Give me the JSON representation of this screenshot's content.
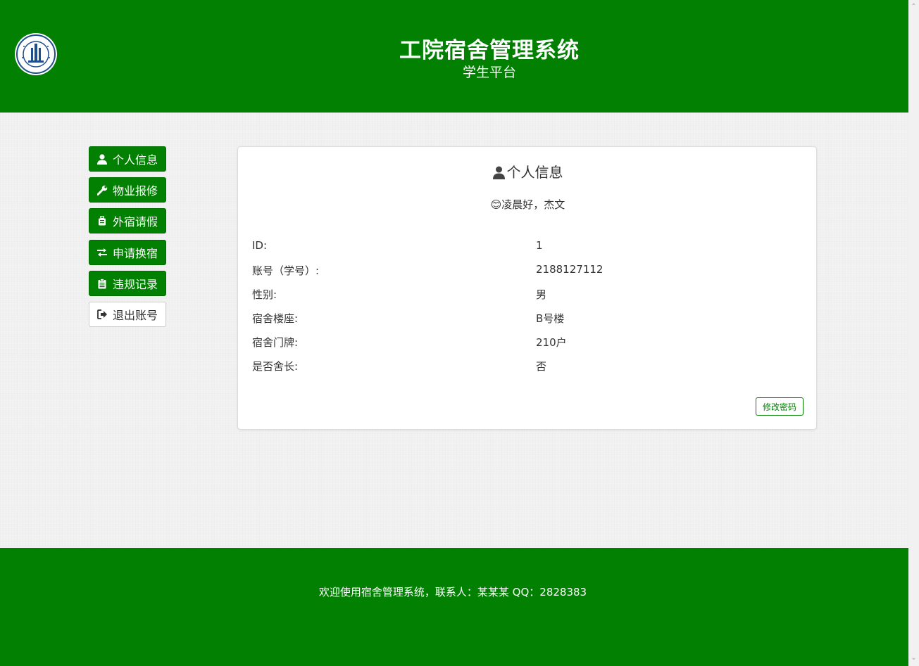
{
  "header": {
    "title": "工院宿舍管理系统",
    "subtitle": "学生平台",
    "logo_icon": "university-seal-logo"
  },
  "sidebar": {
    "items": [
      {
        "label": "个人信息",
        "icon": "user-icon"
      },
      {
        "label": "物业报修",
        "icon": "wrench-icon"
      },
      {
        "label": "外宿请假",
        "icon": "suitcase-icon"
      },
      {
        "label": "申请换宿",
        "icon": "exchange-icon"
      },
      {
        "label": "违规记录",
        "icon": "clipboard-icon"
      },
      {
        "label": "退出账号",
        "icon": "sign-out-icon"
      }
    ]
  },
  "panel": {
    "title": "个人信息",
    "greeting": "😊凌晨好，杰文",
    "fields": [
      {
        "label": "ID:",
        "value": "1"
      },
      {
        "label": "账号（学号）:",
        "value": "2188127112"
      },
      {
        "label": "性别:",
        "value": "男"
      },
      {
        "label": "宿舍楼座:",
        "value": "B号楼"
      },
      {
        "label": "宿舍门牌:",
        "value": "210户"
      },
      {
        "label": "是否舍长:",
        "value": "否"
      }
    ],
    "change_password_label": "修改密码"
  },
  "footer": {
    "text": "欢迎使用宿舍管理系统，联系人：某某某 QQ：2828383"
  },
  "colors": {
    "primary_green": "#018001",
    "background": "#f2f2f2"
  }
}
